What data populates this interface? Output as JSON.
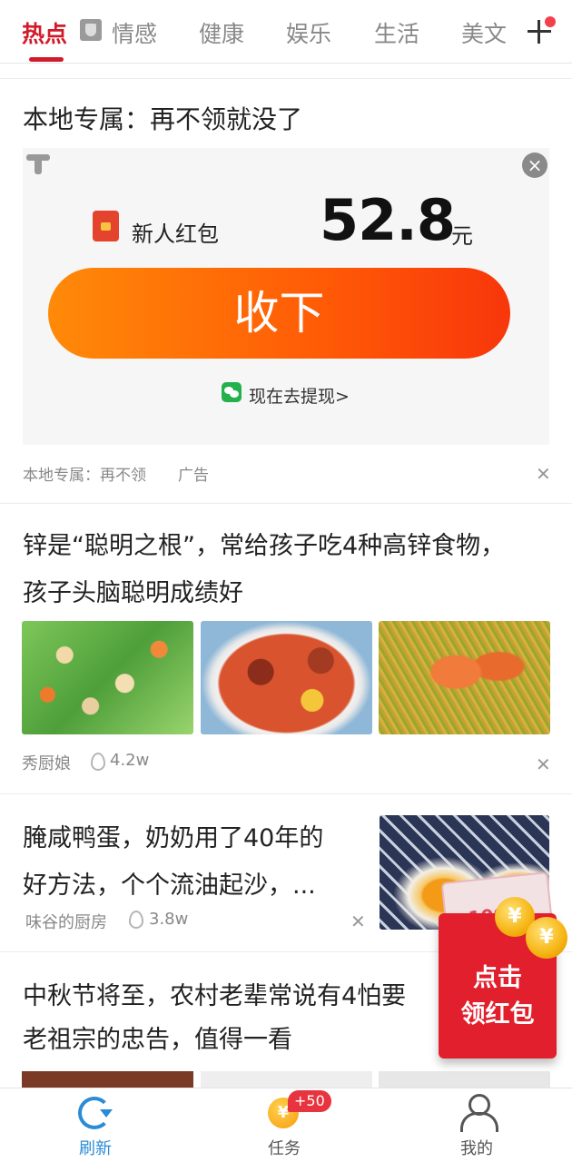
{
  "tabs": [
    {
      "label": "热点",
      "active": true
    },
    {
      "label": "情感"
    },
    {
      "label": "健康"
    },
    {
      "label": "娱乐"
    },
    {
      "label": "生活"
    },
    {
      "label": "美文"
    }
  ],
  "ad": {
    "title": "本地专属：再不领就没了",
    "bonus_label": "新人红包",
    "amount": "52.8",
    "unit": "元",
    "button_label": "收下",
    "withdraw_label": "现在去提现>",
    "source": "本地专属：再不领",
    "tag": "广告"
  },
  "articles": [
    {
      "title_line1": "锌是“聪明之根”，常给孩子吃4种高锌食物，",
      "title_line2": "孩子头脑聪明成绩好",
      "author": "秀厨娘",
      "views": "4.2w"
    },
    {
      "title_line1": "腌咸鸭蛋，奶奶用了40年的",
      "title_line2": "好方法，个个流油起沙，...",
      "author": "味谷的厨房",
      "views": "3.8w"
    },
    {
      "title_line1": "中秋节将至，农村老辈常说有4怕要",
      "title_line2": "老祖宗的忠告，值得一看"
    }
  ],
  "floating_packet": {
    "label_line1": "点击",
    "label_line2": "领红包"
  },
  "bottom_nav": {
    "refresh": "刷新",
    "tasks": "任务",
    "tasks_badge": "+50",
    "mine": "我的"
  },
  "colors": {
    "accent": "#d21b2a",
    "button_start": "#ff8a08",
    "button_end": "#f8360b",
    "nav_active": "#2a8bd6"
  }
}
